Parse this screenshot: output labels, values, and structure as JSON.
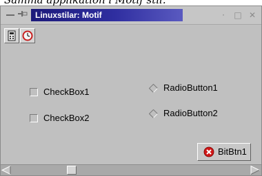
{
  "caption": "Samma applikation i Motif stil.",
  "window": {
    "title": "Linuxstilar: Motif",
    "buttons": {
      "menu_icon": "dash-icon",
      "pin_icon": "pin-icon",
      "minimize_icon": "dot-icon",
      "maximize_icon": "square-icon",
      "close_icon": "x-icon"
    }
  },
  "toolbar": {
    "buttons": [
      {
        "icon": "calculator-icon"
      },
      {
        "icon": "clock-icon"
      }
    ]
  },
  "controls": {
    "checkbox1": {
      "label": "CheckBox1",
      "checked": false
    },
    "checkbox2": {
      "label": "CheckBox2",
      "checked": false
    },
    "radio1": {
      "label": "RadioButton1",
      "selected": false
    },
    "radio2": {
      "label": "RadioButton2",
      "selected": false
    },
    "bitbtn": {
      "label": "BitBtn1",
      "icon": "stop-icon"
    }
  },
  "scrollbar": {
    "orientation": "horizontal"
  },
  "colors": {
    "window_bg": "#c0c0c0",
    "title_bg_start": "#1c1a7a",
    "title_bg_end": "#5a5ac0"
  }
}
